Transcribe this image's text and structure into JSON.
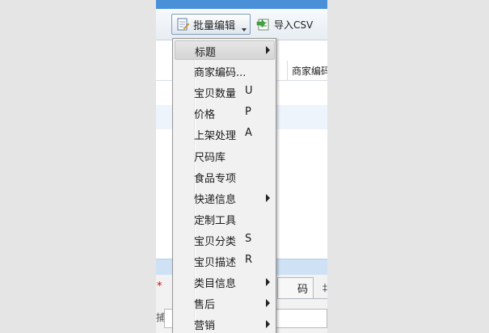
{
  "toolbar": {
    "batch_edit_label": "批量编辑",
    "import_csv_label": "导入CSV"
  },
  "table": {
    "partial_column_header": "商家编码",
    "asterisk": "*"
  },
  "bottom_tabs": {
    "tab_1_partial": "码",
    "tab_2_partial": "‡"
  },
  "left_edge_partial": "捕",
  "menu": {
    "items": [
      {
        "label": "标题",
        "key": "",
        "submenu": true,
        "highlighted": true
      },
      {
        "label": "商家编码...",
        "key": "",
        "submenu": false,
        "highlighted": false
      },
      {
        "label": "宝贝数量",
        "key": "U",
        "submenu": false,
        "highlighted": false
      },
      {
        "label": "价格",
        "key": "P",
        "submenu": false,
        "highlighted": false
      },
      {
        "label": "上架处理",
        "key": "A",
        "submenu": false,
        "highlighted": false
      },
      {
        "label": "尺码库",
        "key": "",
        "submenu": false,
        "highlighted": false
      },
      {
        "label": "食品专项",
        "key": "",
        "submenu": false,
        "highlighted": false
      },
      {
        "label": "快递信息",
        "key": "",
        "submenu": true,
        "highlighted": false
      },
      {
        "label": "定制工具",
        "key": "",
        "submenu": false,
        "highlighted": false
      },
      {
        "label": "宝贝分类",
        "key": "S",
        "submenu": false,
        "highlighted": false
      },
      {
        "label": "宝贝描述",
        "key": "R",
        "submenu": false,
        "highlighted": false
      },
      {
        "label": "类目信息",
        "key": "",
        "submenu": true,
        "highlighted": false
      },
      {
        "label": "售后",
        "key": "",
        "submenu": true,
        "highlighted": false
      },
      {
        "label": "营销",
        "key": "",
        "submenu": true,
        "highlighted": false
      }
    ]
  },
  "colors": {
    "title_bar": "#4a90d9",
    "menu_background": "#f1f1f1",
    "selection_row": "#cfe2f5",
    "required_marker": "#e00000"
  },
  "icons": {
    "batch_edit": "edit-document-icon",
    "import_csv": "import-csv-icon",
    "submenu": "chevron-right-icon"
  }
}
